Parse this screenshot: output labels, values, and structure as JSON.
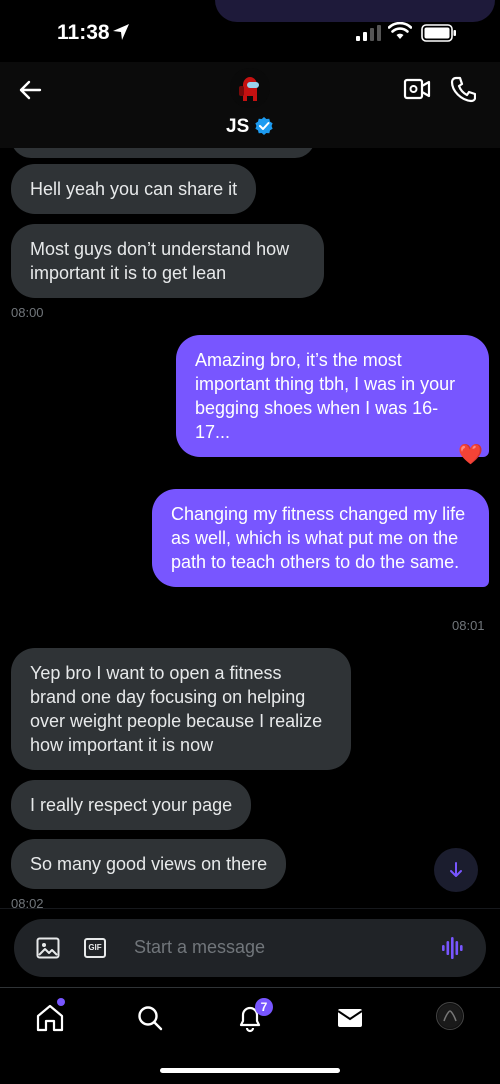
{
  "status_bar": {
    "time": "11:38"
  },
  "header": {
    "contact_name": "JS",
    "back_icon": "arrow-left-icon",
    "video_icon": "video-call-icon",
    "call_icon": "phone-icon"
  },
  "messages": [
    {
      "from": "them",
      "text": "Hell yeah you can share it"
    },
    {
      "from": "them",
      "text": "Most guys don’t understand how important it is to get lean"
    },
    {
      "from": "me",
      "text": "Amazing bro, it’s the most important thing tbh, I was in your begging shoes when I was 16-17..."
    },
    {
      "from": "me",
      "text": "Changing my fitness changed my life as well, which is what put me on the path to teach others to do the same."
    },
    {
      "from": "them",
      "text": "Yep bro I want to open a fitness brand one day focusing on helping over weight people because I realize how important it is now"
    },
    {
      "from": "them",
      "text": "I really respect your page"
    },
    {
      "from": "them",
      "text": "So many good views on there"
    }
  ],
  "timestamps": [
    "08:00",
    "08:01",
    "08:02"
  ],
  "reaction": "❤️",
  "composer": {
    "placeholder": "Start a message",
    "gif_label": "GIF"
  },
  "nav": {
    "notifications_count": "7"
  },
  "colors": {
    "accent": "#7856ff",
    "incoming_bubble": "#2f3336",
    "background": "#000000"
  }
}
